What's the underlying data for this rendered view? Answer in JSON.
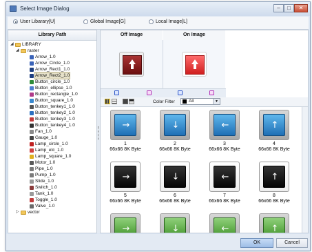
{
  "window": {
    "title": "Select Image Dialog"
  },
  "sources": [
    {
      "label": "User Libarary[U]",
      "selected": true
    },
    {
      "label": "Global Image[G]",
      "selected": false
    },
    {
      "label": "Local Image[L]",
      "selected": false
    }
  ],
  "library": {
    "header": "Library Path",
    "root": "LIBRARY",
    "raster": "raster",
    "items": [
      {
        "label": "Arrow_1.0",
        "icon": "arrow-icon",
        "color": "#3a63b8"
      },
      {
        "label": "Arrow_Circle_1.0",
        "icon": "arrow-circle-icon",
        "color": "#3a63b8"
      },
      {
        "label": "Arrow_Rect1_1.0",
        "icon": "arrow-rect-icon",
        "color": "#1e3f80"
      },
      {
        "label": "Arrow_Rect2_1.0",
        "icon": "arrow-rect-icon",
        "color": "#1e3f80",
        "selected": true
      },
      {
        "label": "Button_circle_1.0",
        "icon": "button-circle-icon",
        "color": "#2e8c3a"
      },
      {
        "label": "Button_ellipse_1.0",
        "icon": "button-ellipse-icon",
        "color": "#4f7fd0"
      },
      {
        "label": "Button_rectangle_1.0",
        "icon": "button-rectangle-icon",
        "color": "#b03a8a"
      },
      {
        "label": "Button_square_1.0",
        "icon": "button-square-icon",
        "color": "#3a8ad0"
      },
      {
        "label": "Button_tenkey1_1.0",
        "icon": "tenkey-icon",
        "color": "#555555"
      },
      {
        "label": "Button_tenkey2_1.0",
        "icon": "tenkey-icon",
        "color": "#2a6fc0"
      },
      {
        "label": "Button_tenkey3_1.0",
        "icon": "tenkey-icon",
        "color": "#c03a3a"
      },
      {
        "label": "Button_tenkey4_1.0",
        "icon": "tenkey-icon",
        "color": "#333333"
      },
      {
        "label": "Fan_1.0",
        "icon": "fan-icon",
        "color": "#8a8a8a"
      },
      {
        "label": "Gauge_1.0",
        "icon": "gauge-icon",
        "color": "#444444"
      },
      {
        "label": "Lamp_circle_1.0",
        "icon": "lamp-circle-icon",
        "color": "#c02020"
      },
      {
        "label": "Lamp_etc_1.0",
        "icon": "lamp-icon",
        "color": "#d04040"
      },
      {
        "label": "Lamp_square_1.0",
        "icon": "lamp-square-icon",
        "color": "#e0b020"
      },
      {
        "label": "Motor_1.0",
        "icon": "motor-icon",
        "color": "#5a5a5a"
      },
      {
        "label": "Pipe_1.0",
        "icon": "pipe-icon",
        "color": "#7a7a7a"
      },
      {
        "label": "Pump_1.0",
        "icon": "pump-icon",
        "color": "#7a7a7a"
      },
      {
        "label": "Slide_1.0",
        "icon": "slide-icon",
        "color": "#9a9a9a"
      },
      {
        "label": "Switch_1.0",
        "icon": "switch-icon",
        "color": "#8a3a3a"
      },
      {
        "label": "Tank_1.0",
        "icon": "tank-icon",
        "color": "#9a9a9a"
      },
      {
        "label": "Toggle_1.0",
        "icon": "toggle-icon",
        "color": "#c03a3a"
      },
      {
        "label": "Valve_1.0",
        "icon": "valve-icon",
        "color": "#6a6a6a"
      }
    ],
    "vector": "vector"
  },
  "preview": {
    "off_label": "Off Image",
    "on_label": "On Image",
    "off_color": "#8b1a1a",
    "on_color": "#e83a3a"
  },
  "filter": {
    "label": "Color Filter",
    "value": "All"
  },
  "images": [
    {
      "num": "1",
      "size": "66x66 8K Byte",
      "style": "blue",
      "arrow": "→"
    },
    {
      "num": "2",
      "size": "66x66 8K Byte",
      "style": "blue",
      "arrow": "↓"
    },
    {
      "num": "3",
      "size": "66x66 8K Byte",
      "style": "blue",
      "arrow": "←"
    },
    {
      "num": "4",
      "size": "66x66 8K Byte",
      "style": "blue",
      "arrow": "↑"
    },
    {
      "num": "5",
      "size": "66x66 8K Byte",
      "style": "black",
      "arrow": "→"
    },
    {
      "num": "6",
      "size": "66x66 8K Byte",
      "style": "black",
      "arrow": "↓"
    },
    {
      "num": "7",
      "size": "66x66 8K Byte",
      "style": "black",
      "arrow": "←"
    },
    {
      "num": "8",
      "size": "66x66 8K Byte",
      "style": "black",
      "arrow": "↑"
    },
    {
      "num": "",
      "size": "",
      "style": "green",
      "arrow": "→"
    },
    {
      "num": "",
      "size": "",
      "style": "green",
      "arrow": "↓"
    },
    {
      "num": "",
      "size": "",
      "style": "green",
      "arrow": "←"
    },
    {
      "num": "",
      "size": "",
      "style": "green",
      "arrow": "↑"
    }
  ],
  "buttons": {
    "ok": "OK",
    "cancel": "Cancel"
  }
}
